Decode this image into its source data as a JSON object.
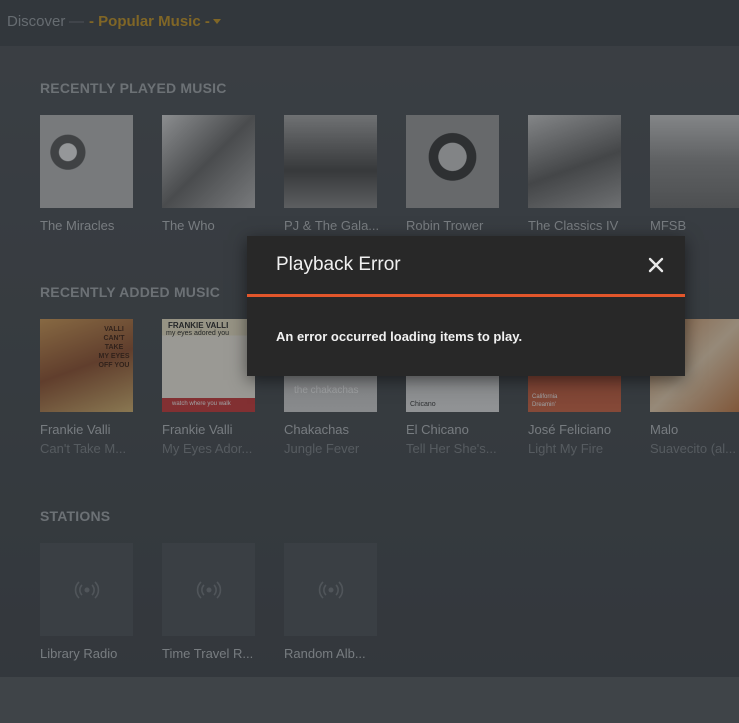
{
  "header": {
    "discover": "Discover",
    "separator": "—",
    "current": "- Popular Music -"
  },
  "sections": {
    "recently_played": {
      "title": "RECENTLY PLAYED MUSIC",
      "items": [
        {
          "title": "The Miracles"
        },
        {
          "title": "The Who"
        },
        {
          "title": "PJ & The Gala..."
        },
        {
          "title": "Robin Trower"
        },
        {
          "title": "The Classics IV"
        },
        {
          "title": "MFSB"
        }
      ]
    },
    "recently_added": {
      "title": "RECENTLY ADDED MUSIC",
      "items": [
        {
          "title": "Frankie Valli",
          "subtitle": "Can't Take M..."
        },
        {
          "title": "Frankie Valli",
          "subtitle": "My Eyes Ador..."
        },
        {
          "title": "Chakachas",
          "subtitle": "Jungle Fever"
        },
        {
          "title": "El Chicano",
          "subtitle": "Tell Her She's..."
        },
        {
          "title": "José Feliciano",
          "subtitle": "Light My Fire"
        },
        {
          "title": "Malo",
          "subtitle": "Suavecito (al..."
        }
      ]
    },
    "stations": {
      "title": "STATIONS",
      "items": [
        {
          "title": "Library Radio"
        },
        {
          "title": "Time Travel R..."
        },
        {
          "title": "Random Alb..."
        }
      ]
    }
  },
  "album_art_text": {
    "frankie_valli_1": [
      "VALLI",
      "CAN'T TAKE",
      "MY EYES",
      "OFF YOU"
    ],
    "frankie_valli_2": [
      "FRANKIE VALLI",
      "my eyes adored you",
      "watch where you walk"
    ],
    "chakachas": "the chakachas",
    "el_chicano": "Chicano",
    "jose_feliciano": "California Dreamin'"
  },
  "modal": {
    "title": "Playback Error",
    "message": "An error occurred loading items to play."
  },
  "colors": {
    "accent": "#c9961e",
    "modal_divider": "#e2562b"
  },
  "icons": {
    "close": "close-icon",
    "station": "radio-signal-icon",
    "dropdown": "caret-down-icon"
  }
}
